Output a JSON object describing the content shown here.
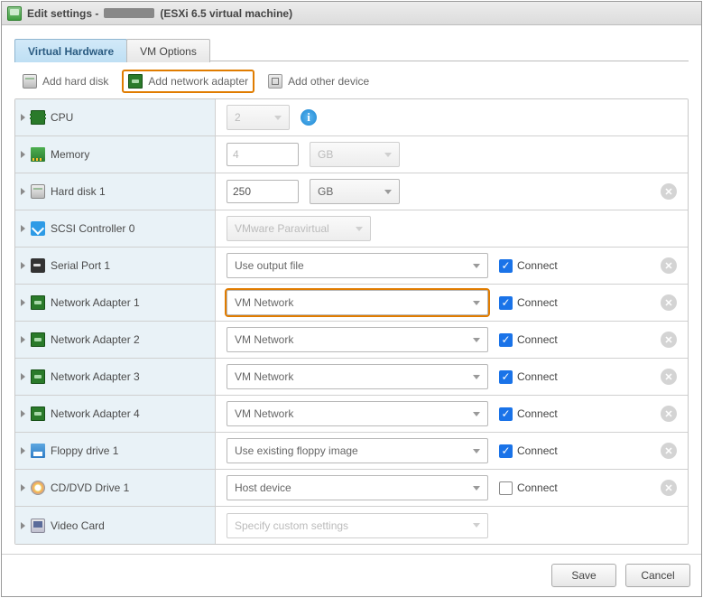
{
  "title": {
    "prefix": "Edit settings -",
    "suffix": "(ESXi 6.5 virtual machine)"
  },
  "tabs": {
    "hardware": "Virtual Hardware",
    "options": "VM Options"
  },
  "toolbar": {
    "add_hdd": "Add hard disk",
    "add_nic": "Add network adapter",
    "add_other": "Add other device"
  },
  "rows": {
    "cpu": {
      "label": "CPU",
      "value_ph": "2"
    },
    "mem": {
      "label": "Memory",
      "value_ph": "4",
      "unit": "GB"
    },
    "hd1": {
      "label": "Hard disk 1",
      "value": "250",
      "unit": "GB"
    },
    "scsi": {
      "label": "SCSI Controller 0",
      "value": "VMware Paravirtual"
    },
    "ser1": {
      "label": "Serial Port 1",
      "value": "Use output file"
    },
    "nic1": {
      "label": "Network Adapter 1",
      "value": "VM Network"
    },
    "nic2": {
      "label": "Network Adapter 2",
      "value": "VM Network"
    },
    "nic3": {
      "label": "Network Adapter 3",
      "value": "VM Network"
    },
    "nic4": {
      "label": "Network Adapter 4",
      "value": "VM Network"
    },
    "fd1": {
      "label": "Floppy drive 1",
      "value": "Use existing floppy image"
    },
    "cd1": {
      "label": "CD/DVD Drive 1",
      "value": "Host device"
    },
    "vid": {
      "label": "Video Card",
      "value_ph": "Specify custom settings"
    }
  },
  "labels": {
    "connect": "Connect"
  },
  "buttons": {
    "save": "Save",
    "cancel": "Cancel"
  }
}
